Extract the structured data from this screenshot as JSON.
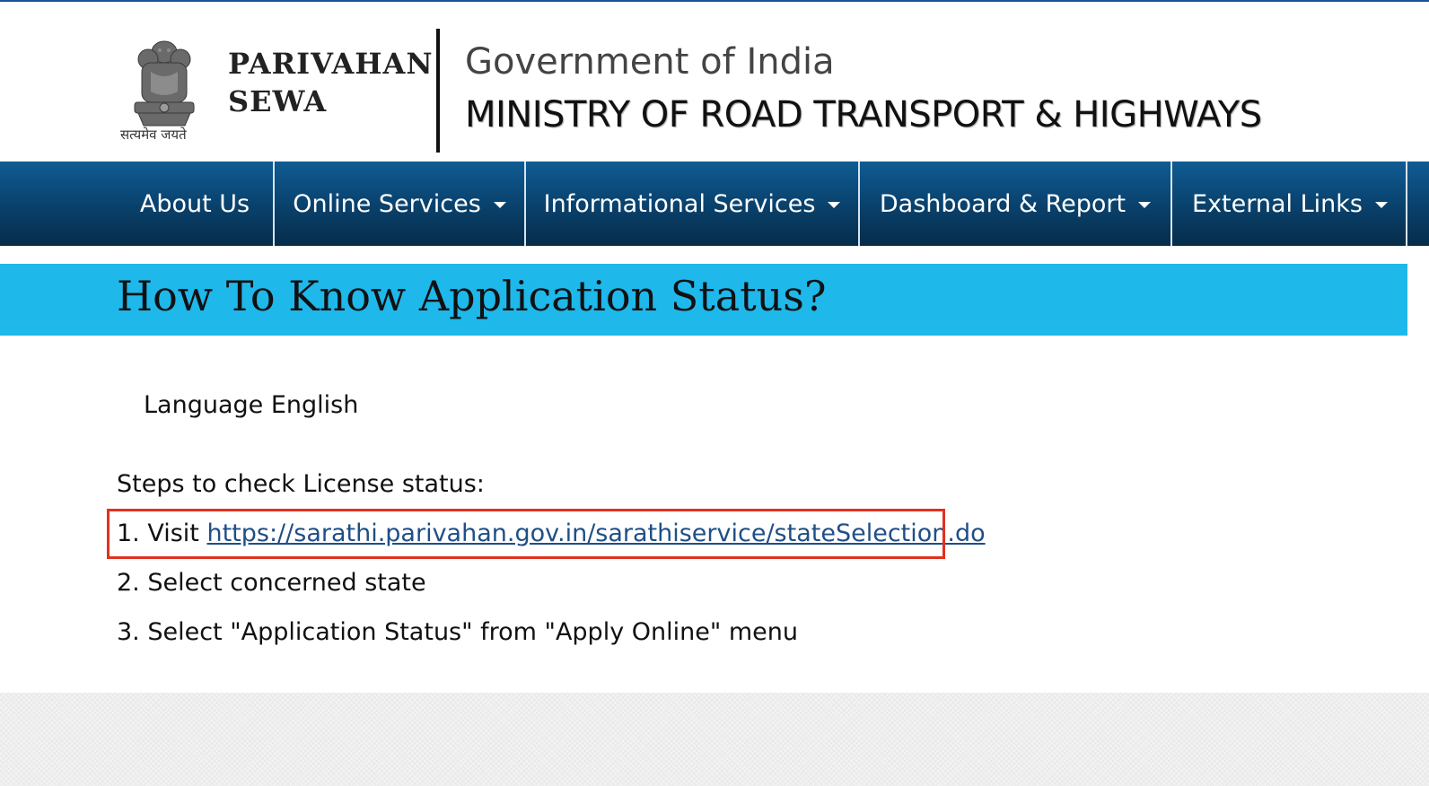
{
  "header": {
    "brand_line1": "PARIVAHAN",
    "brand_line2": "SEWA",
    "emblem_motto": "सत्यमेव जयते",
    "government": "Government of India",
    "ministry": "MINISTRY OF ROAD TRANSPORT & HIGHWAYS",
    "emblem_icon": "national-emblem-icon"
  },
  "nav": {
    "items": [
      {
        "label": "About Us",
        "has_dropdown": false
      },
      {
        "label": "Online Services",
        "has_dropdown": true
      },
      {
        "label": "Informational Services",
        "has_dropdown": true
      },
      {
        "label": "Dashboard & Report",
        "has_dropdown": true
      },
      {
        "label": "External Links",
        "has_dropdown": true
      }
    ]
  },
  "page": {
    "title": "How To Know Application Status?",
    "language": "Language English",
    "steps_title": "Steps to check License status:",
    "step1_prefix": "1. Visit ",
    "step1_link": "https://sarathi.parivahan.gov.in/sarathiservice/stateSelection.do",
    "step2": "2. Select concerned state",
    "step3": "3. Select \"Application Status\" from \"Apply Online\" menu"
  },
  "colors": {
    "nav_top": "#0f5c93",
    "nav_bottom": "#062c4a",
    "title_bar": "#1eb8eb",
    "link": "#1f4f86",
    "highlight": "#e0321e"
  }
}
